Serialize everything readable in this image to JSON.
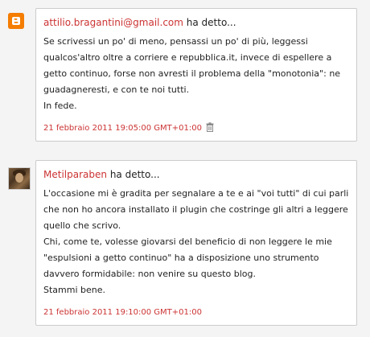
{
  "comments": [
    {
      "author": "attilio.bragantini@gmail.com",
      "says": "ha detto...",
      "avatar_icon": "blogger-icon",
      "body": [
        "Se scrivessi un po' di meno, pensassi un po' di più, leggessi qualcos'altro oltre a corriere e repubblica.it, invece di espellere a getto continuo, forse non avresti il problema della \"monotonia\": ne guadagneresti, e con te noi tutti.",
        "In fede."
      ],
      "timestamp": "21 febbraio 2011 19:05:00 GMT+01:00",
      "has_delete_icon": true
    },
    {
      "author": "Metilparaben",
      "says": "ha detto...",
      "avatar_icon": "user-photo",
      "body": [
        "L'occasione mi è gradita per segnalare a te e ai \"voi tutti\" di cui parli che non ho ancora installato il plugin che costringe gli altri a leggere quello che scrivo.",
        "Chi, come te, volesse giovarsi del beneficio di non leggere le mie \"espulsioni a getto continuo\" ha a disposizione uno strumento davvero formidabile: non venire su questo blog.",
        "Stammi bene."
      ],
      "timestamp": "21 febbraio 2011 19:10:00 GMT+01:00",
      "has_delete_icon": false
    }
  ],
  "colors": {
    "accent": "#cc3333",
    "blogger_orange": "#f57d00",
    "border": "#cccccc",
    "background": "#f4f4f4"
  }
}
